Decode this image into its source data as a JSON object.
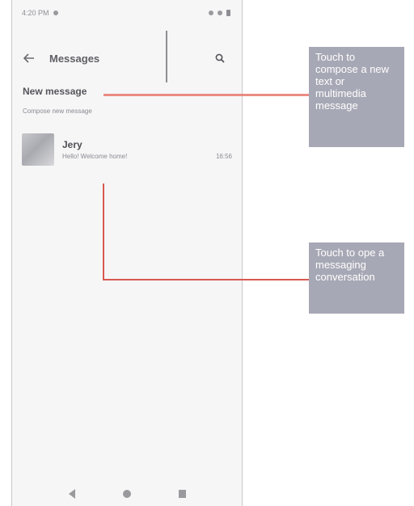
{
  "status_bar": {
    "time": "4:20 PM"
  },
  "app_bar": {
    "title": "Messages"
  },
  "new_message": {
    "label": "New message",
    "subtitle": "Compose new message"
  },
  "conversations": [
    {
      "name": "Jery",
      "preview": "Hello! Welcome home!",
      "time": "16:56"
    }
  ],
  "callouts": {
    "compose": "Touch to compose a new text or multimedia message",
    "open": "Touch to ope a messaging conversation"
  },
  "colors": {
    "callout_bg": "#a7a8b5",
    "leader": "#e8796d",
    "phone_bg": "#f6f6f7"
  },
  "icons": [
    "back-arrow-icon",
    "search-icon",
    "nav-back-icon",
    "nav-home-icon",
    "nav-recents-icon"
  ]
}
